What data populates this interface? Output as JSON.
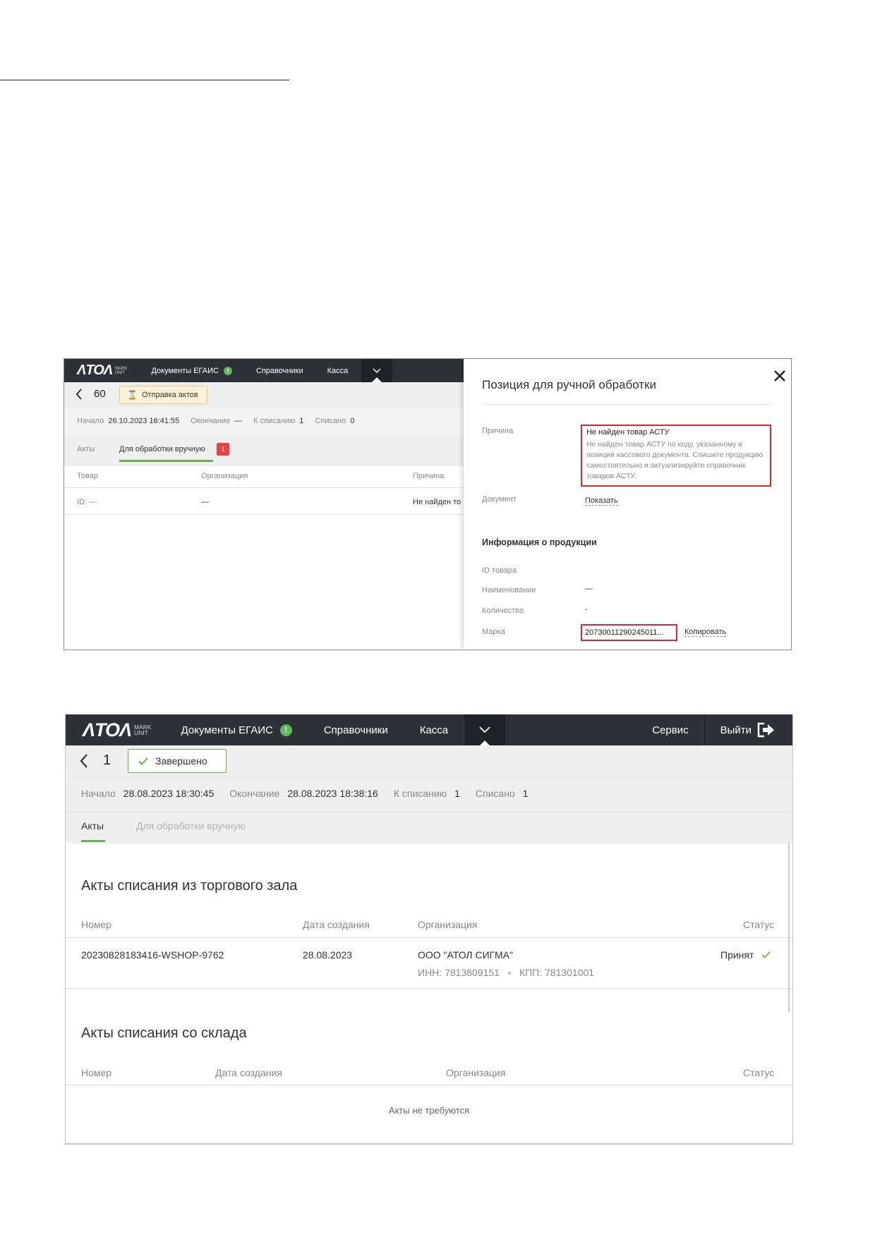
{
  "shot1": {
    "nav": {
      "logo": "ΛTOΛ",
      "logo_sub_top": "MARK",
      "logo_sub_bottom": "UNIT",
      "items": [
        "Документы ЕГАИС",
        "Справочники",
        "Касса"
      ],
      "egais_badge": "!"
    },
    "header": {
      "number": "60",
      "status": "Отправка актов"
    },
    "meta": {
      "start_label": "Начало",
      "start_value": "26.10.2023 16:41:55",
      "end_label": "Окончание",
      "end_value": "—",
      "writeoff_label": "К списанию",
      "writeoff_value": "1",
      "written_label": "Списано",
      "written_value": "0"
    },
    "tabs": {
      "acts": "Акты",
      "manual": "Для обработки вручную",
      "manual_count": "1"
    },
    "table": {
      "headers": [
        "Товар",
        "Организация",
        "Причина"
      ],
      "row": {
        "product": "ID: —",
        "org": "—",
        "reason": "Не найден то"
      }
    },
    "panel": {
      "title": "Позиция для ручной обработки",
      "reason_label": "Причина",
      "reason_title": "Не найден товар АСТУ",
      "reason_text": "Не найден товар АСТУ по коду, указанному в позиции кассового документа. Спишите продукцию самостоятельно и актуализируйте справочник товаров АСТУ.",
      "document_label": "Документ",
      "document_link": "Показать",
      "product_info_title": "Информация о продукции",
      "id_label": "ID товара",
      "name_label": "Наименование",
      "name_value": "—",
      "qty_label": "Количество",
      "qty_value": "-",
      "mark_label": "Марка",
      "mark_value": "20730011290245011...",
      "copy_link": "Копировать"
    }
  },
  "shot2": {
    "nav": {
      "logo": "ΛTOΛ",
      "logo_sub_top": "MARK",
      "logo_sub_bottom": "UNIT",
      "items": [
        "Документы ЕГАИС",
        "Справочники",
        "Касса"
      ],
      "egais_badge": "!",
      "service": "Сервис",
      "logout": "Выйти"
    },
    "header": {
      "number": "1",
      "status": "Завершено"
    },
    "meta": {
      "start_label": "Начало",
      "start_value": "28.08.2023 18:30:45",
      "end_label": "Окончание",
      "end_value": "28.08.2023 18:38:16",
      "writeoff_label": "К списанию",
      "writeoff_value": "1",
      "written_label": "Списано",
      "written_value": "1"
    },
    "tabs": {
      "acts": "Акты",
      "manual": "Для обработки вручную"
    },
    "hall": {
      "title": "Акты списания из торгового зала",
      "headers": [
        "Номер",
        "Дата создания",
        "Организация",
        "Статус"
      ],
      "row": {
        "number": "20230828183416-WSHOP-9762",
        "date": "28.08.2023",
        "org": "ООО \"АТОЛ СИГМА\"",
        "inn": "ИНН: 7813609151",
        "kpp": "КПП: 781301001",
        "status": "Принят"
      }
    },
    "warehouse": {
      "title": "Акты списания со склада",
      "headers": [
        "Номер",
        "Дата создания",
        "Организация",
        "Статус"
      ],
      "empty": "Акты не требуются"
    }
  },
  "colors": {
    "accent_green": "#6ab04c",
    "alert_red": "#d92b2b",
    "nav_bg": "#2d3238",
    "pending_bg": "#fff2d9"
  }
}
